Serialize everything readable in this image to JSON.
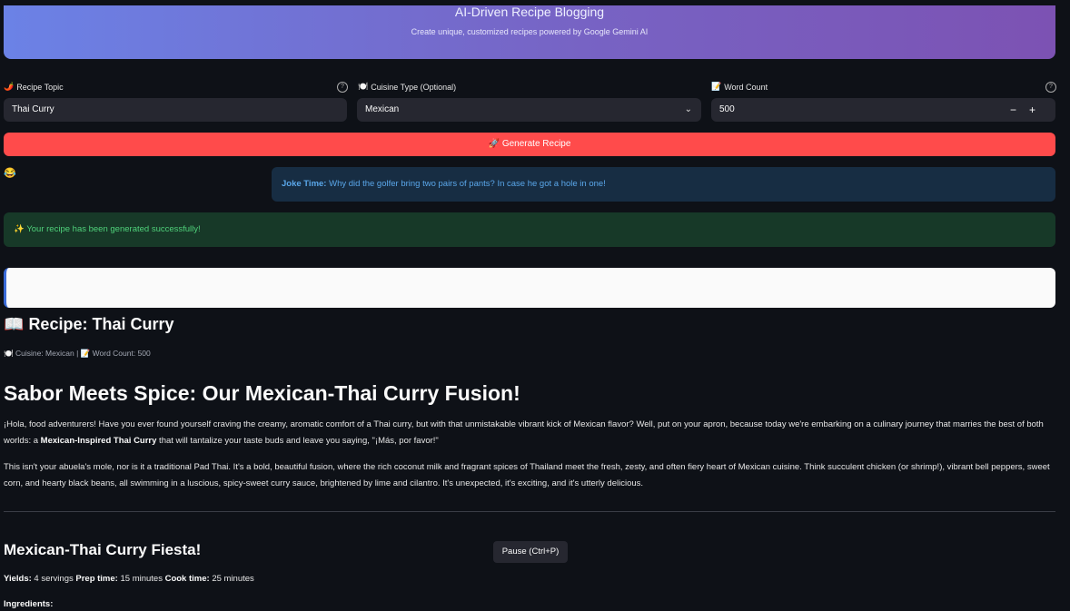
{
  "header": {
    "title": "AI-Driven Recipe Blogging",
    "subtitle": "Create unique, customized recipes powered by Google Gemini AI"
  },
  "form": {
    "topic": {
      "icon": "chili-pepper-icon",
      "icon_glyph": "🌶️",
      "label": "Recipe Topic",
      "value": "Thai Curry"
    },
    "cuisine": {
      "icon": "plate-icon",
      "icon_glyph": "🍽️",
      "label": "Cuisine Type (Optional)",
      "value": "Mexican"
    },
    "word_count": {
      "icon": "memo-icon",
      "icon_glyph": "📝",
      "label": "Word Count",
      "value": "500",
      "minus": "−",
      "plus": "+"
    },
    "help_glyph": "?",
    "chevron_glyph": "⌄"
  },
  "generate_button": {
    "icon_glyph": "🚀",
    "label": "Generate Recipe"
  },
  "loading_emoji": "😂",
  "joke": {
    "prefix": "Joke Time:",
    "text": " Why did the golfer bring two pairs of pants? In case he got a hole in one!"
  },
  "success": {
    "icon_glyph": "✨",
    "text": "Your recipe has been generated successfully!"
  },
  "recipe": {
    "heading_icon": "📖",
    "heading": "Recipe: Thai Curry",
    "meta_cuisine_icon": "🍽️",
    "meta_cuisine": "Cuisine: Mexican",
    "meta_sep": "|",
    "meta_wc_icon": "📝",
    "meta_wc": "Word Count: 500",
    "title": "Sabor Meets Spice: Our Mexican-Thai Curry Fusion!",
    "para1_a": "¡Hola, food adventurers! Have you ever found yourself craving the creamy, aromatic comfort of a Thai curry, but with that unmistakable vibrant kick of Mexican flavor? Well, put on your apron, because today we're embarking on a culinary journey that marries the best of both worlds: a ",
    "para1_bold": "Mexican-Inspired Thai Curry",
    "para1_b": " that will tantalize your taste buds and leave you saying, \"¡Más, por favor!\"",
    "para2": "This isn't your abuela's mole, nor is it a traditional Pad Thai. It's a bold, beautiful fusion, where the rich coconut milk and fragrant spices of Thailand meet the fresh, zesty, and often fiery heart of Mexican cuisine. Think succulent chicken (or shrimp!), vibrant bell peppers, sweet corn, and hearty black beans, all swimming in a luscious, spicy-sweet curry sauce, brightened by lime and cilantro. It's unexpected, it's exciting, and it's utterly delicious.",
    "section_title": "Mexican-Thai Curry Fiesta!",
    "yields_label": "Yields:",
    "yields_value": " 4 servings ",
    "prep_label": "Prep time:",
    "prep_value": " 15 minutes ",
    "cook_label": "Cook time:",
    "cook_value": " 25 minutes",
    "ingredients_label": "Ingredients:"
  },
  "overlay": {
    "pause_label": "Pause (Ctrl+P)"
  }
}
